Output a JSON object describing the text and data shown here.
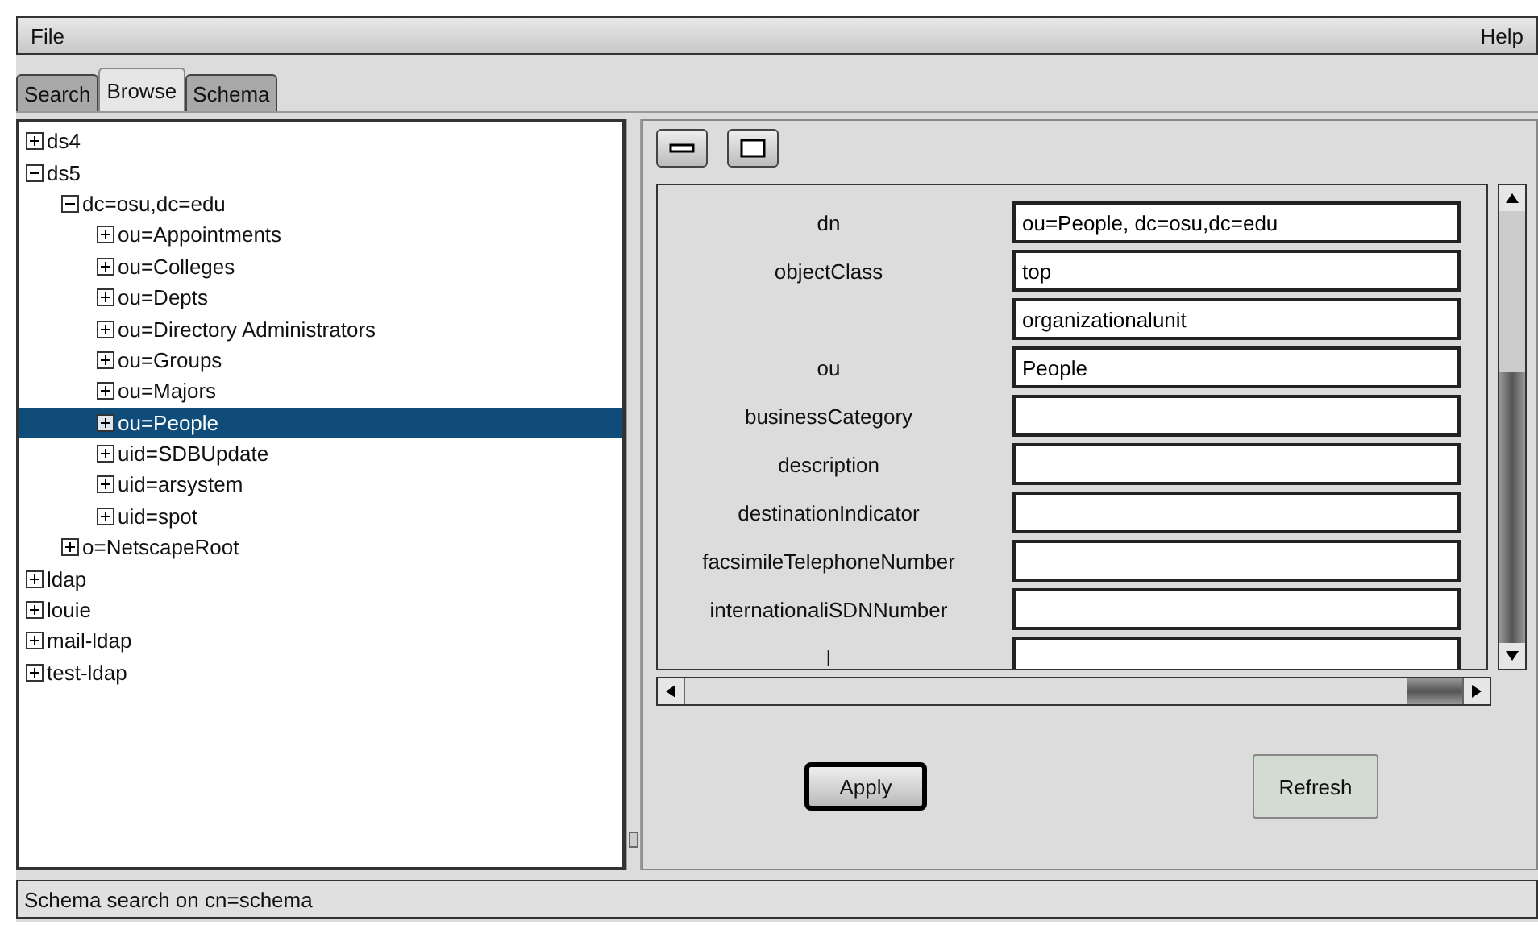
{
  "menu": [
    "File",
    "Help"
  ],
  "tabs": [
    {
      "label": "Search",
      "selected": false
    },
    {
      "label": "Browse",
      "selected": true
    },
    {
      "label": "Schema",
      "selected": false
    }
  ],
  "tree": [
    {
      "label": "ds4",
      "expanded": false,
      "selected": false
    },
    {
      "label": "ds5",
      "expanded": true,
      "selected": false,
      "children": [
        {
          "label": "dc=osu,dc=edu",
          "expanded": true,
          "selected": false,
          "children": [
            {
              "label": "ou=Appointments",
              "expanded": false,
              "selected": false
            },
            {
              "label": "ou=Colleges",
              "expanded": false,
              "selected": false
            },
            {
              "label": "ou=Depts",
              "expanded": false,
              "selected": false
            },
            {
              "label": "ou=Directory Administrators",
              "expanded": false,
              "selected": false
            },
            {
              "label": "ou=Groups",
              "expanded": false,
              "selected": false
            },
            {
              "label": "ou=Majors",
              "expanded": false,
              "selected": false
            },
            {
              "label": "ou=People",
              "expanded": false,
              "selected": true
            },
            {
              "label": "uid=SDBUpdate",
              "expanded": false,
              "selected": false
            },
            {
              "label": "uid=arsystem",
              "expanded": false,
              "selected": false
            },
            {
              "label": "uid=spot",
              "expanded": false,
              "selected": false
            }
          ]
        },
        {
          "label": "o=NetscapeRoot",
          "expanded": false,
          "selected": false
        }
      ]
    },
    {
      "label": "ldap",
      "expanded": false,
      "selected": false
    },
    {
      "label": "louie",
      "expanded": false,
      "selected": false
    },
    {
      "label": "mail-ldap",
      "expanded": false,
      "selected": false
    },
    {
      "label": "test-ldap",
      "expanded": false,
      "selected": false
    }
  ],
  "attributes": [
    {
      "name": "dn",
      "values": [
        "ou=People, dc=osu,dc=edu"
      ]
    },
    {
      "name": "objectClass",
      "values": [
        "top",
        "organizationalunit"
      ]
    },
    {
      "name": "ou",
      "values": [
        "People"
      ]
    },
    {
      "name": "businessCategory"
    },
    {
      "name": "description"
    },
    {
      "name": "destinationIndicator"
    },
    {
      "name": "facsimileTelephoneNumber"
    },
    {
      "name": "internationaliSDNNumber"
    },
    {
      "name": "l"
    }
  ],
  "buttons": [
    {
      "label": "Apply",
      "default": true
    },
    {
      "label": "Refresh",
      "default": false
    }
  ],
  "status_bar": "Schema search on cn=schema"
}
